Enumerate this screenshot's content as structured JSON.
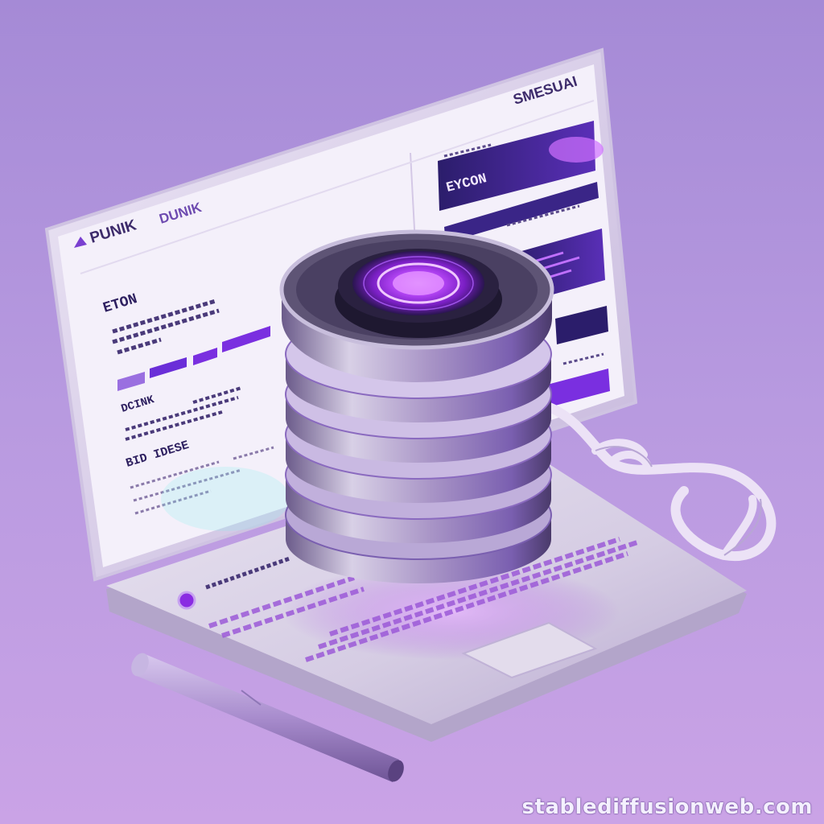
{
  "scene": {
    "description_free": true,
    "colors": {
      "background_top": "#a98cd6",
      "background_bottom": "#c9a4e4",
      "accent_purple": "#8a2be2",
      "glow": "#c04dff",
      "laptop_silver": "#d9d2e6",
      "screen_panel": "#f3eef9",
      "dark_bar": "#2e1c6b"
    }
  },
  "screen": {
    "logo_text": "PUNIK",
    "logo_text_2": "DUNIK",
    "top_right_brand": "SMESUAI",
    "left_heading": "ETON",
    "left_subheading": "DCINK",
    "left_section": "BID IDESE",
    "right_card_title": "EYCON"
  },
  "icons": {
    "logo": "triangle-logo-icon",
    "device": "database-disk-icon",
    "pen": "stylus-icon",
    "cable": "coiled-cable-icon"
  },
  "watermark": {
    "text": "stablediffusionweb.com"
  }
}
